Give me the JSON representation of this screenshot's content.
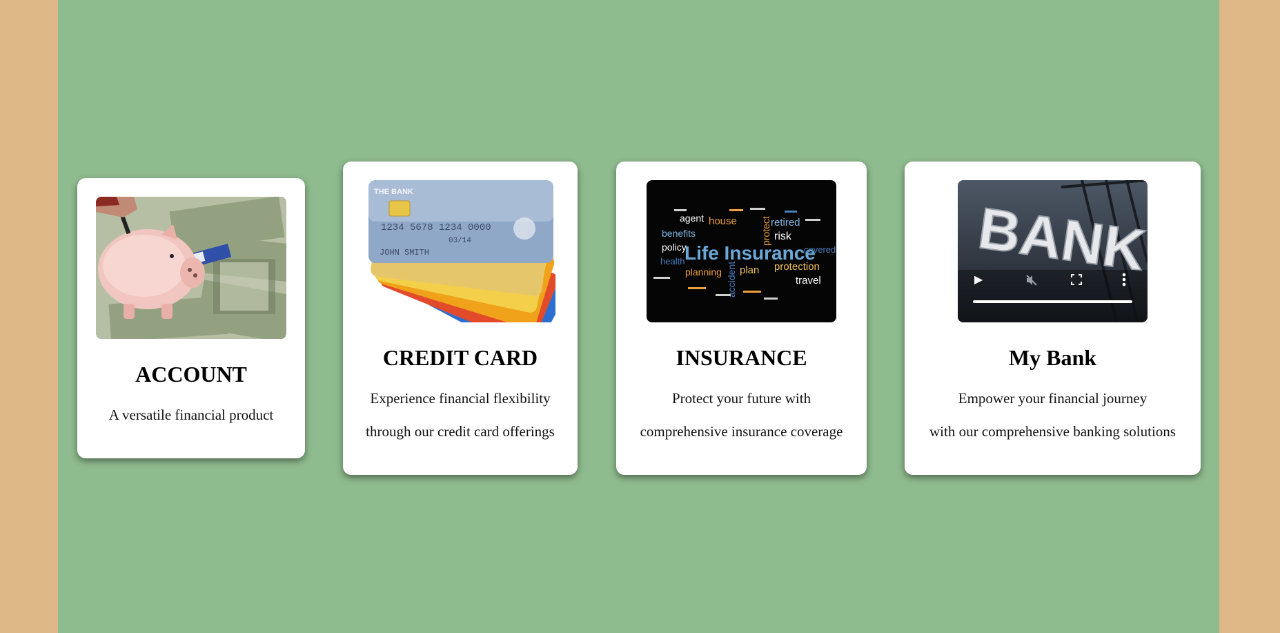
{
  "cards": [
    {
      "title": "ACCOUNT",
      "lines": [
        "A versatile financial product"
      ],
      "media": "piggy-bank-money-photo"
    },
    {
      "title": "CREDIT CARD",
      "lines": [
        "Experience financial flexibility",
        "through our credit card offerings"
      ],
      "media": "credit-cards-photo",
      "image_text": [
        "THE BANK",
        "1234 5678 1234 0000",
        "03/14",
        "JOHN SMITH"
      ]
    },
    {
      "title": "INSURANCE",
      "lines": [
        "Protect your future with",
        "comprehensive insurance coverage"
      ],
      "media": "life-insurance-word-cloud",
      "image_text": [
        "Life Insurance",
        "benefits",
        "policy",
        "agent",
        "house",
        "retired",
        "risk",
        "protect",
        "plan",
        "protection",
        "travel",
        "health",
        "planning",
        "accident",
        "covered"
      ]
    },
    {
      "title": "My Bank",
      "lines": [
        "Empower your financial journey",
        "with our comprehensive banking solutions"
      ],
      "media": "bank-video-player",
      "image_text": [
        "BANK"
      ]
    }
  ],
  "colors": {
    "page_background": "#DEB887",
    "content_background": "#8FBC8F",
    "card_background": "#FFFFFF"
  },
  "video_controls": {
    "play_icon": "play-icon",
    "mute_icon": "muted-speaker-icon",
    "fullscreen_icon": "fullscreen-icon",
    "menu_icon": "more-vertical-icon"
  }
}
